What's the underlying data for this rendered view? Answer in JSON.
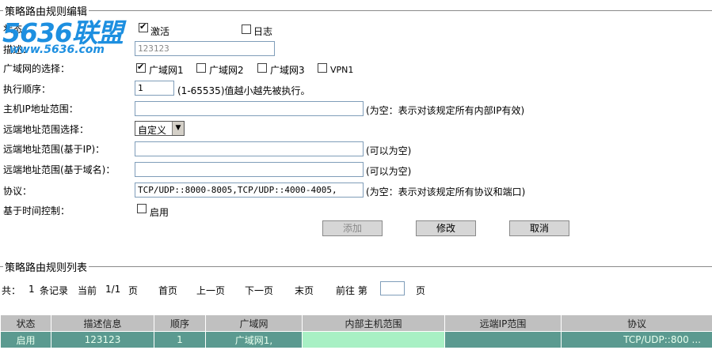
{
  "edit_section": {
    "title": "策略路由规则编辑",
    "status_label": "状态：",
    "activate_label": "激活",
    "activate_checked": true,
    "log_label": "日志",
    "log_checked": false,
    "desc_label": "描述：",
    "desc_value": "123123",
    "wan_label": "广域网的选择：",
    "wan_options": [
      {
        "label": "广域网1",
        "checked": true
      },
      {
        "label": "广域网2",
        "checked": false
      },
      {
        "label": "广域网3",
        "checked": false
      },
      {
        "label": "VPN1",
        "checked": false
      }
    ],
    "order_label": "执行顺序：",
    "order_value": "1",
    "order_hint": "(1-65535)值越小越先被执行。",
    "host_ip_label": "主机IP地址范围：",
    "host_ip_value": "",
    "host_ip_hint": "(为空：表示对该规定所有内部IP有效)",
    "remote_select_label": "远端地址范围选择：",
    "remote_select_value": "自定义",
    "remote_ip_label": "远端地址范围(基于IP)：",
    "remote_ip_value": "",
    "remote_ip_hint": "(可以为空)",
    "remote_domain_label": "远端地址范围(基于域名)：",
    "remote_domain_value": "",
    "remote_domain_hint": "(可以为空)",
    "protocol_label": "协议：",
    "protocol_value": "TCP/UDP::8000-8005,TCP/UDP::4000-4005,",
    "protocol_hint": "(为空：表示对该规定所有协议和端口)",
    "time_label": "基于时间控制：",
    "time_enable_label": "启用",
    "time_enable_checked": false,
    "add_button": "添加",
    "modify_button": "修改",
    "cancel_button": "取消"
  },
  "logo": {
    "main_num": "5636",
    "main_cn": "联盟",
    "url": "www.5636.com"
  },
  "list_section": {
    "title": "策略路由规则列表",
    "pager": {
      "total_prefix": "共：",
      "count": "1",
      "records_text": "条记录",
      "current_label": "当前",
      "pages": "1/1",
      "page_unit": "页",
      "first": "首页",
      "prev": "上一页",
      "next": "下一页",
      "last": "末页",
      "goto_label": "前往 第",
      "goto_value": "",
      "goto_unit": "页"
    },
    "columns": [
      "状态",
      "描述信息",
      "顺序",
      "广域网",
      "内部主机范围",
      "远端IP范围",
      "协议"
    ],
    "rows": [
      [
        "启用",
        "123123",
        "1",
        "广域网1,",
        "",
        "",
        "TCP/UDP::800 ..."
      ]
    ]
  }
}
